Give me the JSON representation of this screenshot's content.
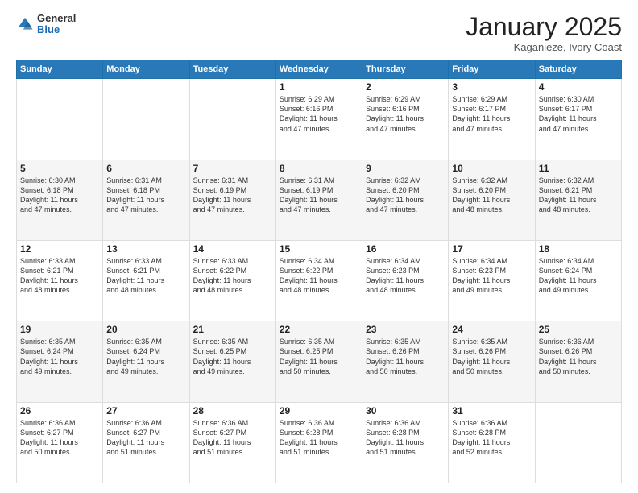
{
  "header": {
    "logo": {
      "general": "General",
      "blue": "Blue"
    },
    "title": "January 2025",
    "subtitle": "Kaganieze, Ivory Coast"
  },
  "weekdays": [
    "Sunday",
    "Monday",
    "Tuesday",
    "Wednesday",
    "Thursday",
    "Friday",
    "Saturday"
  ],
  "weeks": [
    [
      {
        "day": "",
        "info": ""
      },
      {
        "day": "",
        "info": ""
      },
      {
        "day": "",
        "info": ""
      },
      {
        "day": "1",
        "info": "Sunrise: 6:29 AM\nSunset: 6:16 PM\nDaylight: 11 hours\nand 47 minutes."
      },
      {
        "day": "2",
        "info": "Sunrise: 6:29 AM\nSunset: 6:16 PM\nDaylight: 11 hours\nand 47 minutes."
      },
      {
        "day": "3",
        "info": "Sunrise: 6:29 AM\nSunset: 6:17 PM\nDaylight: 11 hours\nand 47 minutes."
      },
      {
        "day": "4",
        "info": "Sunrise: 6:30 AM\nSunset: 6:17 PM\nDaylight: 11 hours\nand 47 minutes."
      }
    ],
    [
      {
        "day": "5",
        "info": "Sunrise: 6:30 AM\nSunset: 6:18 PM\nDaylight: 11 hours\nand 47 minutes."
      },
      {
        "day": "6",
        "info": "Sunrise: 6:31 AM\nSunset: 6:18 PM\nDaylight: 11 hours\nand 47 minutes."
      },
      {
        "day": "7",
        "info": "Sunrise: 6:31 AM\nSunset: 6:19 PM\nDaylight: 11 hours\nand 47 minutes."
      },
      {
        "day": "8",
        "info": "Sunrise: 6:31 AM\nSunset: 6:19 PM\nDaylight: 11 hours\nand 47 minutes."
      },
      {
        "day": "9",
        "info": "Sunrise: 6:32 AM\nSunset: 6:20 PM\nDaylight: 11 hours\nand 47 minutes."
      },
      {
        "day": "10",
        "info": "Sunrise: 6:32 AM\nSunset: 6:20 PM\nDaylight: 11 hours\nand 48 minutes."
      },
      {
        "day": "11",
        "info": "Sunrise: 6:32 AM\nSunset: 6:21 PM\nDaylight: 11 hours\nand 48 minutes."
      }
    ],
    [
      {
        "day": "12",
        "info": "Sunrise: 6:33 AM\nSunset: 6:21 PM\nDaylight: 11 hours\nand 48 minutes."
      },
      {
        "day": "13",
        "info": "Sunrise: 6:33 AM\nSunset: 6:21 PM\nDaylight: 11 hours\nand 48 minutes."
      },
      {
        "day": "14",
        "info": "Sunrise: 6:33 AM\nSunset: 6:22 PM\nDaylight: 11 hours\nand 48 minutes."
      },
      {
        "day": "15",
        "info": "Sunrise: 6:34 AM\nSunset: 6:22 PM\nDaylight: 11 hours\nand 48 minutes."
      },
      {
        "day": "16",
        "info": "Sunrise: 6:34 AM\nSunset: 6:23 PM\nDaylight: 11 hours\nand 48 minutes."
      },
      {
        "day": "17",
        "info": "Sunrise: 6:34 AM\nSunset: 6:23 PM\nDaylight: 11 hours\nand 49 minutes."
      },
      {
        "day": "18",
        "info": "Sunrise: 6:34 AM\nSunset: 6:24 PM\nDaylight: 11 hours\nand 49 minutes."
      }
    ],
    [
      {
        "day": "19",
        "info": "Sunrise: 6:35 AM\nSunset: 6:24 PM\nDaylight: 11 hours\nand 49 minutes."
      },
      {
        "day": "20",
        "info": "Sunrise: 6:35 AM\nSunset: 6:24 PM\nDaylight: 11 hours\nand 49 minutes."
      },
      {
        "day": "21",
        "info": "Sunrise: 6:35 AM\nSunset: 6:25 PM\nDaylight: 11 hours\nand 49 minutes."
      },
      {
        "day": "22",
        "info": "Sunrise: 6:35 AM\nSunset: 6:25 PM\nDaylight: 11 hours\nand 50 minutes."
      },
      {
        "day": "23",
        "info": "Sunrise: 6:35 AM\nSunset: 6:26 PM\nDaylight: 11 hours\nand 50 minutes."
      },
      {
        "day": "24",
        "info": "Sunrise: 6:35 AM\nSunset: 6:26 PM\nDaylight: 11 hours\nand 50 minutes."
      },
      {
        "day": "25",
        "info": "Sunrise: 6:36 AM\nSunset: 6:26 PM\nDaylight: 11 hours\nand 50 minutes."
      }
    ],
    [
      {
        "day": "26",
        "info": "Sunrise: 6:36 AM\nSunset: 6:27 PM\nDaylight: 11 hours\nand 50 minutes."
      },
      {
        "day": "27",
        "info": "Sunrise: 6:36 AM\nSunset: 6:27 PM\nDaylight: 11 hours\nand 51 minutes."
      },
      {
        "day": "28",
        "info": "Sunrise: 6:36 AM\nSunset: 6:27 PM\nDaylight: 11 hours\nand 51 minutes."
      },
      {
        "day": "29",
        "info": "Sunrise: 6:36 AM\nSunset: 6:28 PM\nDaylight: 11 hours\nand 51 minutes."
      },
      {
        "day": "30",
        "info": "Sunrise: 6:36 AM\nSunset: 6:28 PM\nDaylight: 11 hours\nand 51 minutes."
      },
      {
        "day": "31",
        "info": "Sunrise: 6:36 AM\nSunset: 6:28 PM\nDaylight: 11 hours\nand 52 minutes."
      },
      {
        "day": "",
        "info": ""
      }
    ]
  ]
}
